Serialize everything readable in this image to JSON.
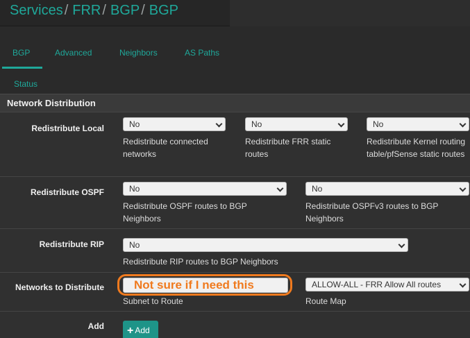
{
  "breadcrumb": {
    "items": [
      "Services",
      "FRR",
      "BGP",
      "BGP"
    ],
    "separator": "/"
  },
  "tabs": [
    {
      "label": "BGP",
      "active": true
    },
    {
      "label": "Advanced",
      "active": false
    },
    {
      "label": "Neighbors",
      "active": false
    },
    {
      "label": "AS Paths",
      "active": false
    },
    {
      "label": "Status",
      "active": false
    }
  ],
  "panel": {
    "title": "Network Distribution"
  },
  "redistribute_local": {
    "label": "Redistribute Local",
    "selects": [
      {
        "value": "No",
        "help": "Redistribute connected networks"
      },
      {
        "value": "No",
        "help": "Redistribute FRR static routes"
      },
      {
        "value": "No",
        "help": "Redistribute Kernel routing table/pfSense static routes"
      }
    ]
  },
  "redistribute_ospf": {
    "label": "Redistribute OSPF",
    "selects": [
      {
        "value": "No",
        "help": "Redistribute OSPF routes to BGP Neighbors"
      },
      {
        "value": "No",
        "help": "Redistribute OSPFv3 routes to BGP Neighbors"
      }
    ]
  },
  "redistribute_rip": {
    "label": "Redistribute RIP",
    "select": {
      "value": "No",
      "help": "Redistribute RIP routes to BGP Neighbors"
    }
  },
  "networks": {
    "label": "Networks to Distribute",
    "subnet_value": "",
    "subnet_help": "Subnet to Route",
    "route_map_value": "ALLOW-ALL - FRR Allow All routes",
    "route_map_help": "Route Map",
    "annotation": "Not sure if I need this"
  },
  "add": {
    "label": "Add",
    "button_label": "Add"
  },
  "colors": {
    "accent": "#1fa89a",
    "annotation": "#f07a1e",
    "background": "#2d2d2d"
  }
}
